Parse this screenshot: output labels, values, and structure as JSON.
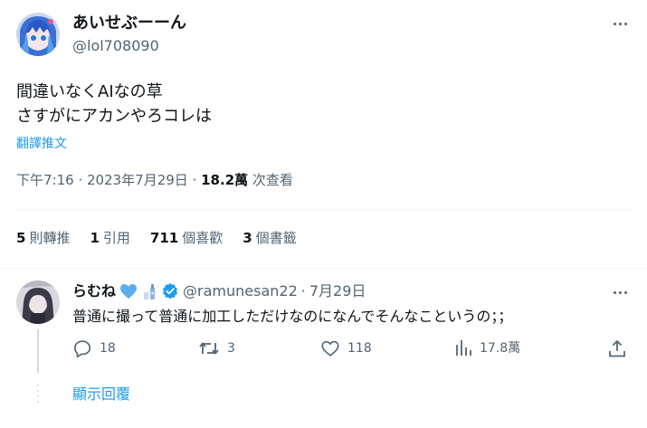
{
  "tweet": {
    "display_name": "あいせぶーーん",
    "handle": "@lol708090",
    "text_line1": "間違いなくAIなの草",
    "text_line2": "さすがにアカンやろコレは",
    "translate_label": "翻譯推文",
    "time": "下午7:16",
    "date": "2023年7月29日",
    "separator": " · ",
    "views_count": "18.2萬",
    "views_label": " 次查看",
    "stats": {
      "retweets_count": "5",
      "retweets_label": "則轉推",
      "quotes_count": "1",
      "quotes_label": "引用",
      "likes_count": "711",
      "likes_label": "個喜歡",
      "bookmarks_count": "3",
      "bookmarks_label": "個書籤"
    }
  },
  "reply": {
    "display_name": "らむね",
    "handle": "@ramunesan22",
    "dot": "·",
    "date": "7月29日",
    "text": "普通に撮って普通に加工しただけなのになんでそんなこというの；；",
    "actions": {
      "replies": "18",
      "retweets": "3",
      "likes": "118",
      "views": "17.8萬"
    },
    "show_replies_label": "顯示回覆"
  },
  "colors": {
    "accent": "#1d9bf0",
    "secondary_text": "#536471",
    "primary_text": "#0f1419",
    "divider": "#eff3f4",
    "heart_emoji": "#5dadec"
  },
  "icons": [
    "more-icon",
    "verified-badge-icon",
    "blue-heart-icon",
    "bottle-icon",
    "reply-icon",
    "retweet-icon",
    "like-icon",
    "views-icon",
    "share-icon"
  ]
}
